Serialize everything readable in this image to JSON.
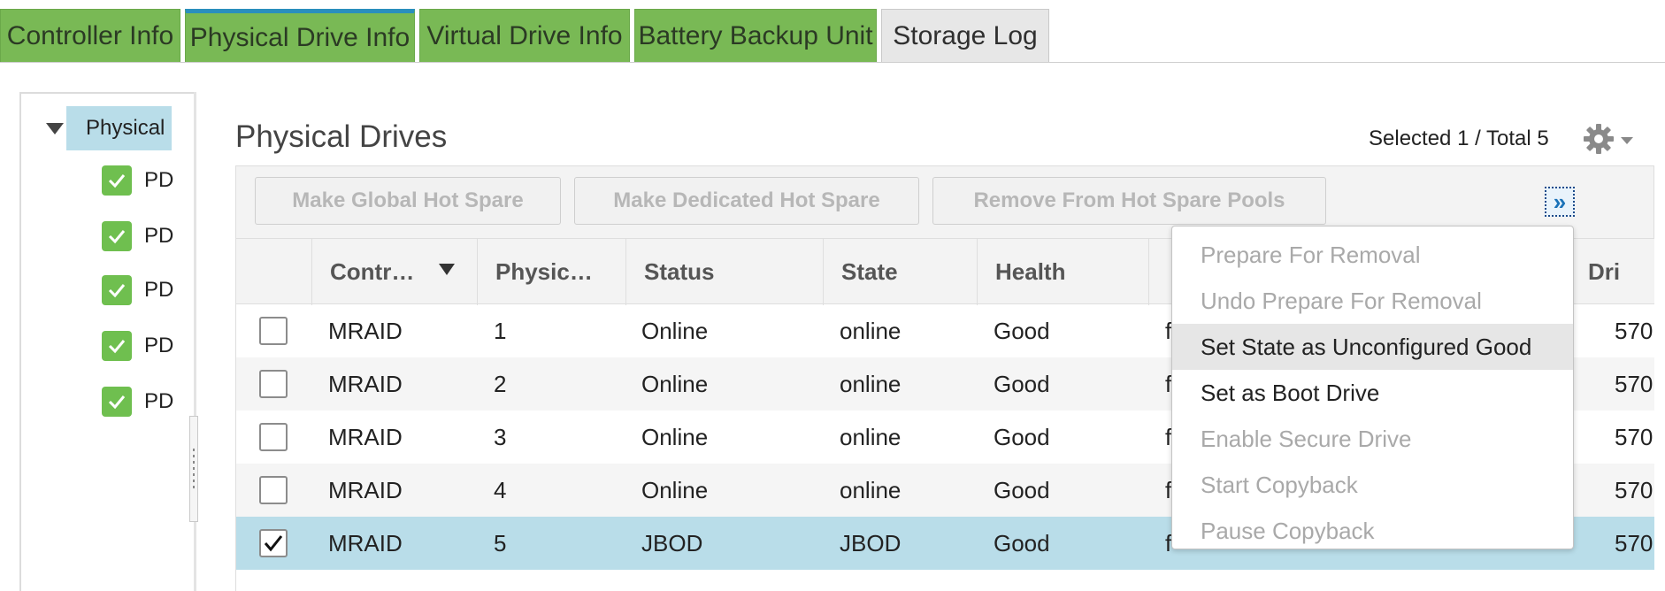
{
  "tabs": [
    {
      "label": "Controller Info"
    },
    {
      "label": "Physical Drive Info"
    },
    {
      "label": "Virtual Drive Info"
    },
    {
      "label": "Battery Backup Unit"
    },
    {
      "label": "Storage Log"
    }
  ],
  "tree": {
    "root": "Physical",
    "items": [
      "PD",
      "PD",
      "PD",
      "PD",
      "PD"
    ]
  },
  "header": {
    "title": "Physical Drives",
    "selection": "Selected 1 / Total 5"
  },
  "toolbar": {
    "make_global": "Make Global Hot Spare",
    "make_dedicated": "Make Dedicated Hot Spare",
    "remove_pools": "Remove From Hot Spare Pools",
    "more": "»"
  },
  "table": {
    "columns": [
      "Contr…",
      "Physic…",
      "Status",
      "State",
      "Health",
      "Dri"
    ],
    "rows": [
      {
        "controller": "MRAID",
        "physical": "1",
        "status": "Online",
        "state": "online",
        "health": "Good",
        "trunc": "f",
        "drive": "570",
        "checked": false
      },
      {
        "controller": "MRAID",
        "physical": "2",
        "status": "Online",
        "state": "online",
        "health": "Good",
        "trunc": "f",
        "drive": "570",
        "checked": false
      },
      {
        "controller": "MRAID",
        "physical": "3",
        "status": "Online",
        "state": "online",
        "health": "Good",
        "trunc": "f",
        "drive": "570",
        "checked": false
      },
      {
        "controller": "MRAID",
        "physical": "4",
        "status": "Online",
        "state": "online",
        "health": "Good",
        "trunc": "f",
        "drive": "570",
        "checked": false
      },
      {
        "controller": "MRAID",
        "physical": "5",
        "status": "JBOD",
        "state": "JBOD",
        "health": "Good",
        "trunc": "f",
        "drive": "570",
        "checked": true
      }
    ]
  },
  "menu": {
    "items": [
      {
        "label": "Prepare For Removal",
        "enabled": false
      },
      {
        "label": "Undo Prepare For Removal",
        "enabled": false
      },
      {
        "label": "Set State as Unconfigured Good",
        "enabled": true,
        "hover": true
      },
      {
        "label": "Set as Boot Drive",
        "enabled": true
      },
      {
        "label": "Enable Secure Drive",
        "enabled": false
      },
      {
        "label": "Start Copyback",
        "enabled": false
      },
      {
        "label": "Pause Copyback",
        "enabled": false
      }
    ]
  },
  "colors": {
    "tab_green": "#79b955",
    "tab_active_top": "#2a8fbd",
    "selection_blue": "#b9dde9",
    "check_green": "#6fbf4f"
  }
}
